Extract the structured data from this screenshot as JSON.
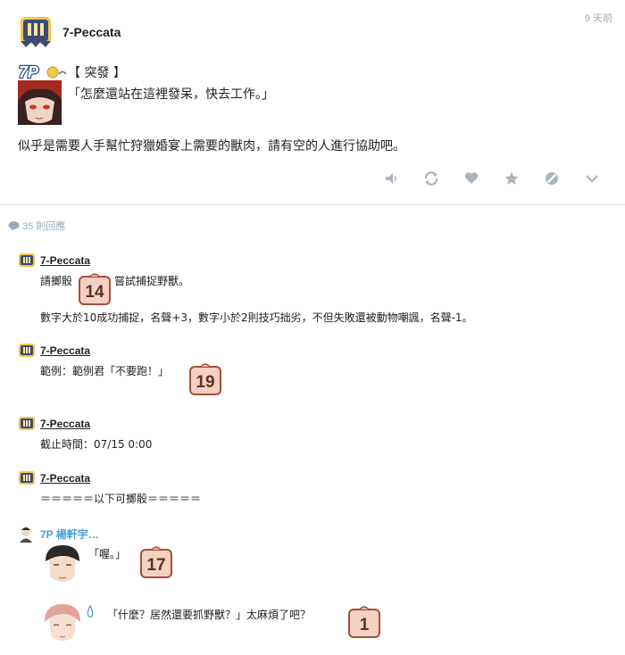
{
  "post": {
    "author": "7-Peccata",
    "time": "9 天前",
    "tag": "【 突發 】",
    "quote": "「怎麼還站在這裡發呆，快去工作。」",
    "body": "似乎是需要人手幫忙狩獵婚宴上需要的獸肉，請有空的人進行協助吧。",
    "logo_text": "7P",
    "actions": [
      "speaker-icon",
      "repost-icon",
      "heart-icon",
      "star-icon",
      "block-icon",
      "chevron-down-icon"
    ]
  },
  "comments_count": "35 則回應",
  "comments": [
    {
      "author": "7-Peccata",
      "lines": [
        "請擲骰",
        "嘗試捕捉野獸。",
        "數字大於10成功捕捉，名聲+3，數字小於2則技巧拙劣，不但失敗還被動物嘲諷，名聲-1。"
      ],
      "dice": "14"
    },
    {
      "author": "7-Peccata",
      "lines": [
        "範例：範例君「不要跑！」"
      ],
      "dice": "19"
    },
    {
      "author": "7-Peccata",
      "lines": [
        "截止時間：07/15 0:00"
      ]
    },
    {
      "author": "7-Peccata",
      "lines": [
        "＝＝＝＝＝以下可擲骰＝＝＝＝＝"
      ]
    },
    {
      "author": "7P 楊軒宇…",
      "quotes": [
        "「喔。」",
        "「什麼？居然還要抓野獸？」太麻煩了吧？"
      ],
      "dice": [
        "17",
        "1"
      ]
    }
  ],
  "colors": {
    "accent": "#4da0d4",
    "dice_fill": "#f6d0c1",
    "dice_border": "#a0523a",
    "meta": "#9aa9b6"
  }
}
